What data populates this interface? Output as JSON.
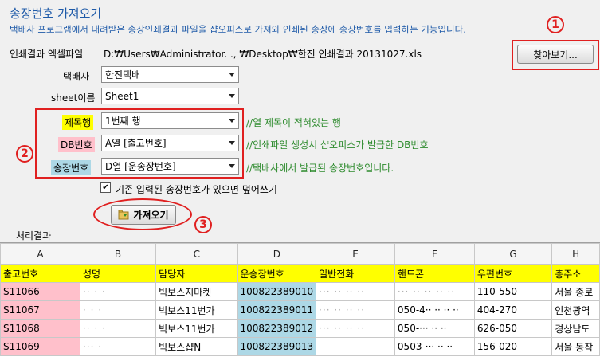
{
  "title": "송장번호 가져오기",
  "description": "택배사 프로그램에서 내려받은 송장인쇄결과 파일을 샵오피스로 가져와 인쇄된 송장에 송장번호를 입력하는 기능입니다.",
  "file": {
    "label": "인쇄결과 엑셀파일",
    "path": "D:₩Users₩Administrator.  ., ₩Desktop₩한진 인쇄결과 20131027.xls",
    "browse_label": "찾아보기..."
  },
  "courier": {
    "label": "택배사",
    "value": "한진택배"
  },
  "sheet": {
    "label": "sheet이름",
    "value": "Sheet1"
  },
  "mapping": [
    {
      "tag": "제목행",
      "tag_color": "#ffff00",
      "value": "1번째 행",
      "comment": "//열 제목이 적혀있는 행"
    },
    {
      "tag": "DB번호",
      "tag_color": "#ffc0cb",
      "value": "A열 [출고번호]",
      "comment": "//인쇄파일 생성시 샵오피스가 발급한 DB번호"
    },
    {
      "tag": "송장번호",
      "tag_color": "#add8e6",
      "value": "D열 [운송장번호]",
      "comment": "//택배사에서 발급된 송장번호입니다."
    }
  ],
  "overwrite_checkbox": {
    "label": "기존 입력된 송장번호가 있으면 덮어쓰기",
    "checked": true
  },
  "import_button": "가져오기",
  "markers": [
    "1",
    "2",
    "3"
  ],
  "result_label": "처리결과",
  "grid": {
    "col_letters": [
      "A",
      "B",
      "C",
      "D",
      "E",
      "F",
      "G",
      "H"
    ],
    "headers": [
      "출고번호",
      "성명",
      "담당자",
      "운송장번호",
      "일반전화",
      "핸드폰",
      "우편번호",
      "총주소"
    ],
    "rows": [
      [
        "S11066",
        "·· ·  ·",
        "빅보스지마켓",
        "100822389010",
        "··· ·· ·· ··",
        "··· ·· ·· ·· ··",
        "110-550",
        "서울 종로"
      ],
      [
        "S11067",
        "· ·  ·",
        "빅보스11번가",
        "100822389011",
        "··· ·· ·· ··",
        "050-4·· ·· ·· ··",
        "404-270",
        "인천광역"
      ],
      [
        "S11068",
        "·· · ·",
        "빅보스11번가",
        "100822389012",
        "··· ·· ·· ··",
        "050-··· ·· ··",
        "626-050",
        "경상남도"
      ],
      [
        "S11069",
        "··· ·",
        "빅보스샵N",
        "100822389013",
        "",
        "0503-··· ·· ··",
        "156-020",
        "서울 동작"
      ]
    ]
  }
}
